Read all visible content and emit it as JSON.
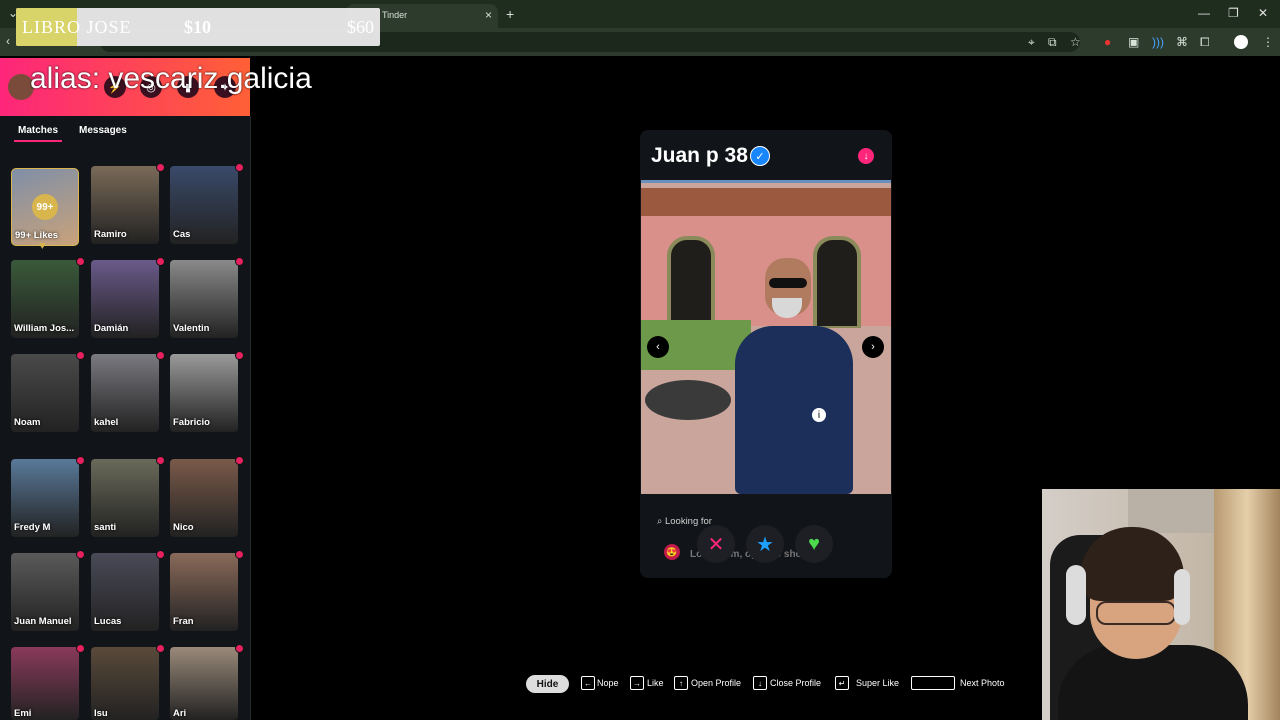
{
  "browser": {
    "tab_title": "Tinder",
    "tab_close": "×",
    "new_tab": "+",
    "minimize": "—",
    "restore": "❐",
    "close": "✕"
  },
  "donation": {
    "title": "LIBRO JOSE",
    "current": "$10",
    "goal": "$60",
    "progress": 0.167
  },
  "alias_overlay": "alias: vescariz.galicia",
  "sidebar": {
    "tabs": [
      "Matches",
      "Messages"
    ],
    "likes_tile": {
      "badge": "99+",
      "label": "99+ Likes"
    },
    "matches": [
      {
        "name": "Ramiro",
        "color": "#7a6a58"
      },
      {
        "name": "Cas",
        "color": "#3a4a6a"
      },
      {
        "name": "William Jos...",
        "color": "#3a5a3a"
      },
      {
        "name": "Damián",
        "color": "#6a5a8a"
      },
      {
        "name": "Valentin",
        "color": "#8a8a8a"
      },
      {
        "name": "Noam",
        "color": "#4a4a4a"
      },
      {
        "name": "kahel",
        "color": "#7a7a80"
      },
      {
        "name": "Fabricio",
        "color": "#9a9a9a"
      },
      {
        "name": "Fredy M",
        "color": "#5a7a9a"
      },
      {
        "name": "santi",
        "color": "#6a6a5a"
      },
      {
        "name": "Nico",
        "color": "#7a5a4a"
      },
      {
        "name": "Juan Manuel",
        "color": "#5a5a5a"
      },
      {
        "name": "Lucas",
        "color": "#4a4a58"
      },
      {
        "name": "Fran",
        "color": "#8a6a5a"
      },
      {
        "name": "Emi",
        "color": "#8a3a5a"
      },
      {
        "name": "Isu",
        "color": "#5a4a3a"
      },
      {
        "name": "Ari",
        "color": "#9a8a7a"
      }
    ]
  },
  "profile": {
    "name_age": "Juan p 38",
    "looking_for_label": "Looking for",
    "looking_for_value": "Long-term, open to short"
  },
  "actions": {
    "nope": "✕",
    "super_like": "★",
    "like": "♥"
  },
  "shortcuts": {
    "hide": "Hide",
    "nope": "Nope",
    "like": "Like",
    "open_profile": "Open Profile",
    "close_profile": "Close Profile",
    "super_like": "Super Like",
    "next_photo": "Next Photo"
  },
  "colors": {
    "tinder_pink": "#fd267a",
    "tinder_orange": "#ff6036",
    "verified_blue": "#1786ff"
  }
}
